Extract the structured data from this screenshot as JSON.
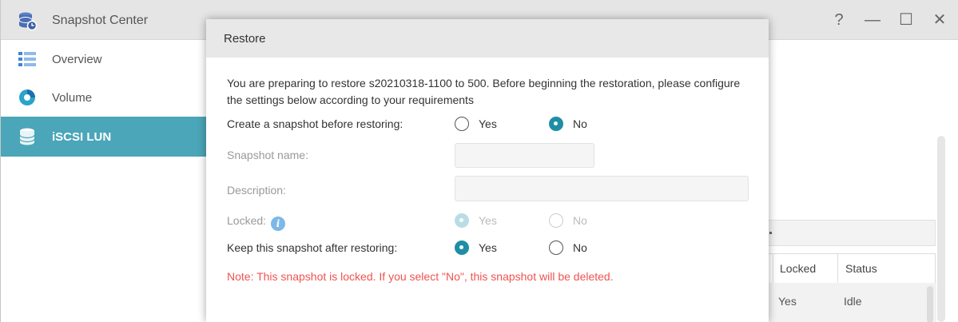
{
  "app": {
    "title": "Snapshot Center",
    "window_controls": {
      "help": "?",
      "minimize": "—",
      "maximize": "☐",
      "close": "✕"
    }
  },
  "sidebar": {
    "items": [
      {
        "label": "Overview",
        "icon": "overview-icon",
        "active": false
      },
      {
        "label": "Volume",
        "icon": "volume-icon",
        "active": false
      },
      {
        "label": "iSCSI LUN",
        "icon": "database-icon",
        "active": true
      }
    ]
  },
  "background_table": {
    "headers": [
      "Locked",
      "Status"
    ],
    "rows": [
      {
        "locked": "Yes",
        "status": "Idle"
      }
    ]
  },
  "dialog": {
    "title": "Restore",
    "intro": "You are preparing to restore s20210318-1100 to 500. Before beginning the restoration, please configure the settings below according to your requirements",
    "create_snapshot": {
      "label": "Create a snapshot before restoring:",
      "options": [
        "Yes",
        "No"
      ],
      "selected": "No"
    },
    "snapshot_name": {
      "label": "Snapshot name:",
      "value": ""
    },
    "description": {
      "label": "Description:",
      "value": ""
    },
    "locked": {
      "label": "Locked:",
      "options": [
        "Yes",
        "No"
      ],
      "selected": "Yes",
      "disabled": true
    },
    "keep_snapshot": {
      "label": "Keep this snapshot after restoring:",
      "options": [
        "Yes",
        "No"
      ],
      "selected": "Yes"
    },
    "note": "Note: This snapshot is locked. If you select \"No\", this snapshot will be deleted."
  },
  "colors": {
    "accent": "#4aa6b8",
    "radio_checked": "#1f8ea5",
    "note": "#ef5350"
  }
}
